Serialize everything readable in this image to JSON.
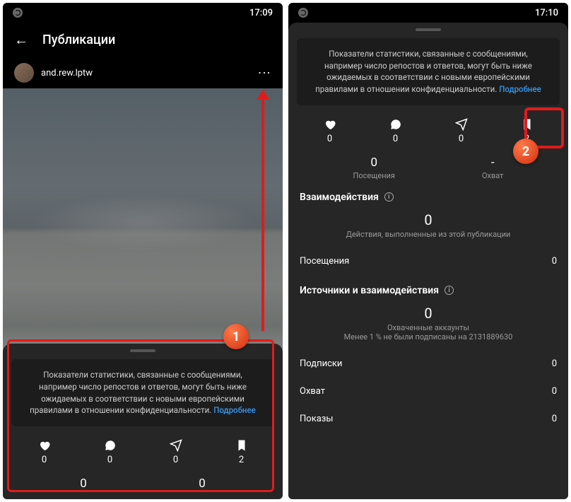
{
  "left": {
    "time": "17:09",
    "header_title": "Публикации",
    "username": "and.rew.lptw",
    "info_text": "Показатели статистики, связанные с сообщениями, например число репостов и ответов, могут быть ниже ожидаемых в соответствии с новыми европейскими правилами в отношении конфиденциальности.",
    "more_label": "Подробнее",
    "stats": {
      "likes": "0",
      "comments": "0",
      "shares": "0",
      "saves": "2"
    },
    "bottom_left_val": "0",
    "bottom_right_val": "0"
  },
  "right": {
    "time": "17:10",
    "info_text": "Показатели статистики, связанные с сообщениями, например число репостов и ответов, могут быть ниже ожидаемых в соответствии с новыми европейскими правилами в отношении конфиденциальности.",
    "more_label": "Подробнее",
    "stats": {
      "likes": "0",
      "comments": "0",
      "shares": "0",
      "saves": "2"
    },
    "visits_label": "Посещения",
    "visits_val": "0",
    "reach_label": "Охват",
    "reach_val": "-",
    "inter_title": "Взаимодействия",
    "inter_zero": "0",
    "inter_sub": "Действия, выполненные из этой публикации",
    "row_visits_label": "Посещения",
    "row_visits_val": "0",
    "sources_title": "Источники и взаимодействия",
    "sources_zero": "0",
    "sources_sub1": "Охваченные аккаунты",
    "sources_sub2": "Менее 1 % не были подписаны на 2131889630",
    "rows": {
      "subs_label": "Подписки",
      "subs_val": "0",
      "reach_label": "Охват",
      "reach_val": "0",
      "imp_label": "Показы",
      "imp_val": "0"
    }
  },
  "badges": {
    "one": "1",
    "two": "2"
  }
}
